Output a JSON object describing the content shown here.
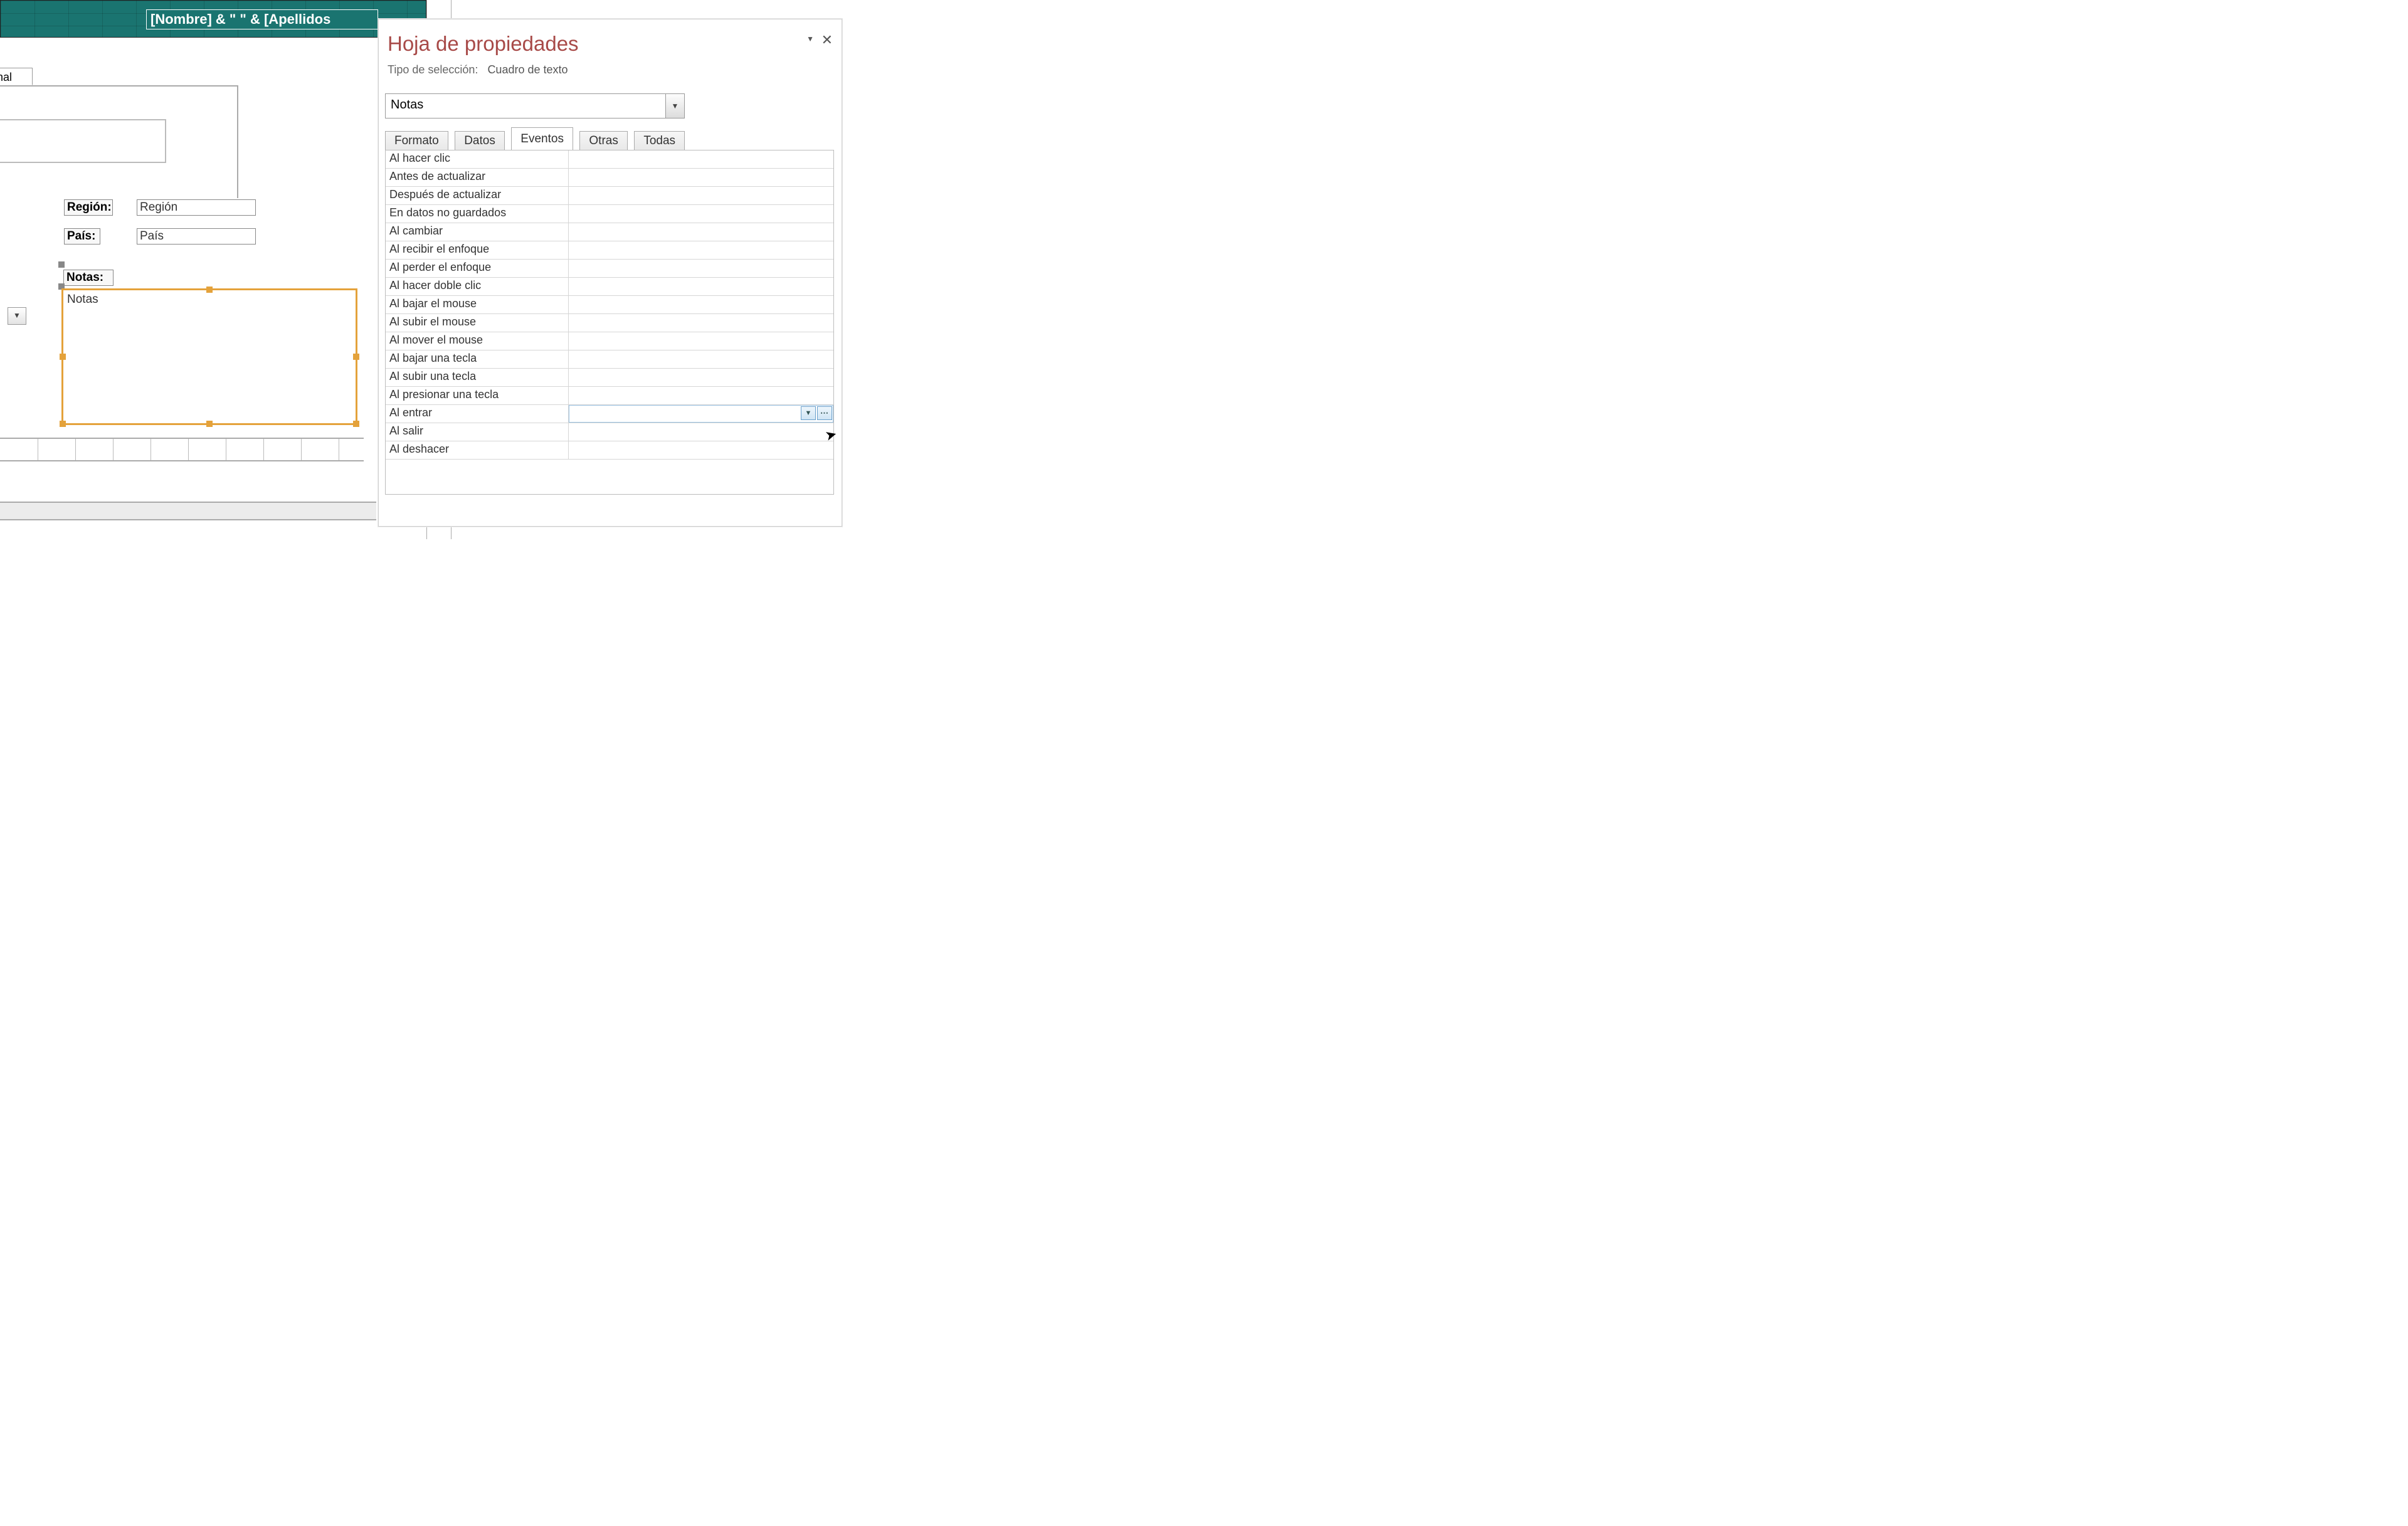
{
  "header": {
    "expression": "[Nombre] & \" \" & [Apellidos"
  },
  "form": {
    "tab_fragment": "nal",
    "region_label": "Región:",
    "region_value": "Región",
    "pais_label": "País:",
    "pais_value": "País",
    "notas_label": "Notas:",
    "notas_value": "Notas"
  },
  "prop": {
    "title": "Hoja de propiedades",
    "sel_prefix": "Tipo de selección:",
    "sel_type": "Cuadro de texto",
    "object": "Notas",
    "tabs": {
      "formato": "Formato",
      "datos": "Datos",
      "eventos": "Eventos",
      "otras": "Otras",
      "todas": "Todas"
    },
    "events": [
      "Al hacer clic",
      "Antes de actualizar",
      "Después de actualizar",
      "En datos no guardados",
      "Al cambiar",
      "Al recibir el enfoque",
      "Al perder el enfoque",
      "Al hacer doble clic",
      "Al bajar el mouse",
      "Al subir el mouse",
      "Al mover el mouse",
      "Al bajar una tecla",
      "Al subir una tecla",
      "Al presionar una tecla",
      "Al entrar",
      "Al salir",
      "Al deshacer"
    ],
    "selected_event_index": 14
  }
}
